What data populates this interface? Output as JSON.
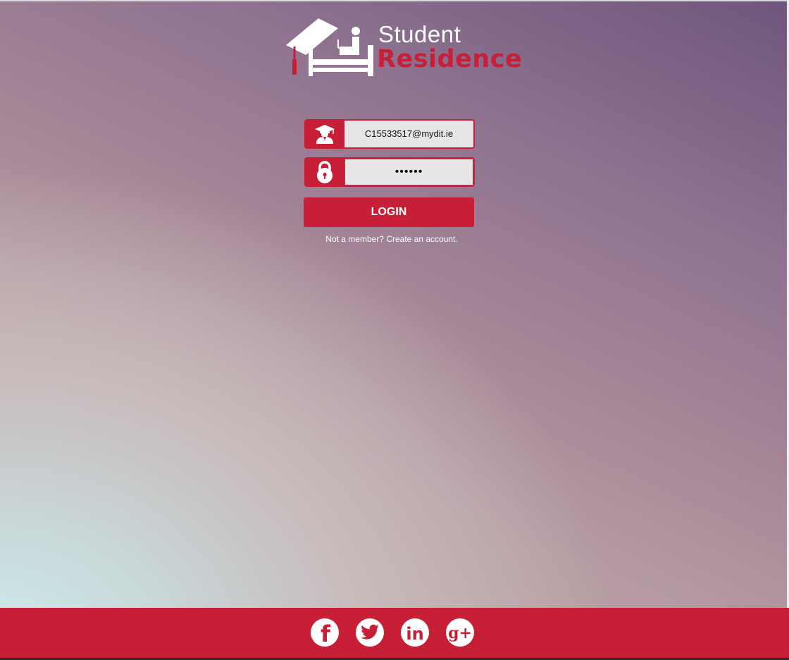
{
  "logo": {
    "word1": "Student",
    "word2": "Residence",
    "icon": "graduation-bed-logo"
  },
  "login_form": {
    "username": {
      "icon": "graduate-icon",
      "value": "C15533517@mydit.ie"
    },
    "password": {
      "icon": "padlock-icon",
      "value": "••••••"
    },
    "login_label": "LOGIN",
    "signup_text": "Not a member? Create an account."
  },
  "footer": {
    "social_links": [
      {
        "name": "facebook",
        "icon": "facebook-icon",
        "glyph": "f"
      },
      {
        "name": "twitter",
        "icon": "twitter-icon"
      },
      {
        "name": "linkedin",
        "icon": "linkedin-icon",
        "glyph": "in"
      },
      {
        "name": "googleplus",
        "icon": "google-plus-icon",
        "glyph": "g+"
      }
    ]
  },
  "colors": {
    "brand_red": "#c81f38",
    "input_bg": "#e6e6e6",
    "white": "#ffffff"
  }
}
